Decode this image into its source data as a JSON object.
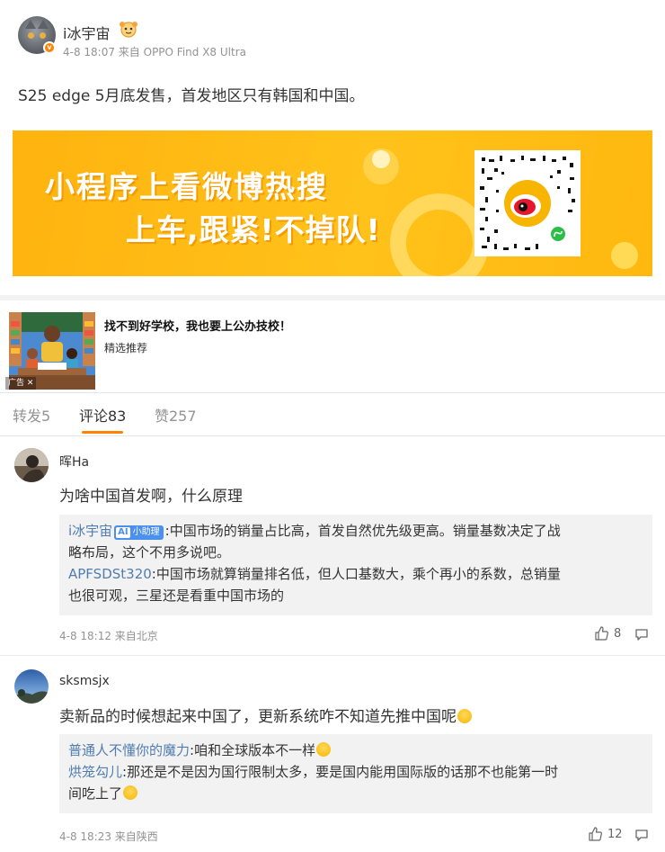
{
  "post": {
    "author": "i冰宇宙",
    "meta": "4-8 18:07 来自 OPPO Find X8 Ultra",
    "text": "S25 edge 5月底发售，首发地区只有韩国和中国。",
    "verified_badge": "v"
  },
  "banner": {
    "line1": "小程序上看微博热搜",
    "line2": "上车,跟紧!不掉队!",
    "colors": {
      "bg": "#ffb30f",
      "text": "#ffffff"
    }
  },
  "ad": {
    "title": "找不到好学校，我也要上公办技校！",
    "subtitle": "精选推荐",
    "tag": "广告 ✕"
  },
  "tabs": [
    {
      "label": "转发5"
    },
    {
      "label": "评论83"
    },
    {
      "label": "赞257"
    }
  ],
  "comments": [
    {
      "name": "晖Ha",
      "text": "为啥中国首发啊，什么原理",
      "replies": [
        {
          "name": "i冰宇宙",
          "badge_icon": "AI",
          "badge": "小助理",
          "line1": ":中国市场的销量占比高，首发自然优先级更高。销量基数决定了战",
          "line2": "略布局，这个不用多说吧。"
        },
        {
          "name": "APFSDSt320",
          "line1": ":中国市场就算销量排名低，但人口基数大，乘个再小的系数，总销量",
          "line2": "也很可观，三星还是看重中国市场的"
        }
      ],
      "meta": "4-8 18:12 来自北京",
      "likes": "8"
    },
    {
      "name": "sksmsjx",
      "text": "卖新品的时候想起来中国了，更新系统咋不知道先推中国呢",
      "replies": [
        {
          "name": "普通人不懂你的魔力",
          "line1": ":咱和全球版本不一样"
        },
        {
          "name": "烘笼勾儿",
          "line1": ":那还是不是因为国行限制太多，要是国内能用国际版的话那不也能第一时",
          "line2": "间吃上了"
        }
      ],
      "meta": "4-8 18:23 来自陕西",
      "likes": "12"
    }
  ],
  "colors": {
    "accent": "#ff8200",
    "link": "#507daf",
    "muted": "#939393"
  }
}
